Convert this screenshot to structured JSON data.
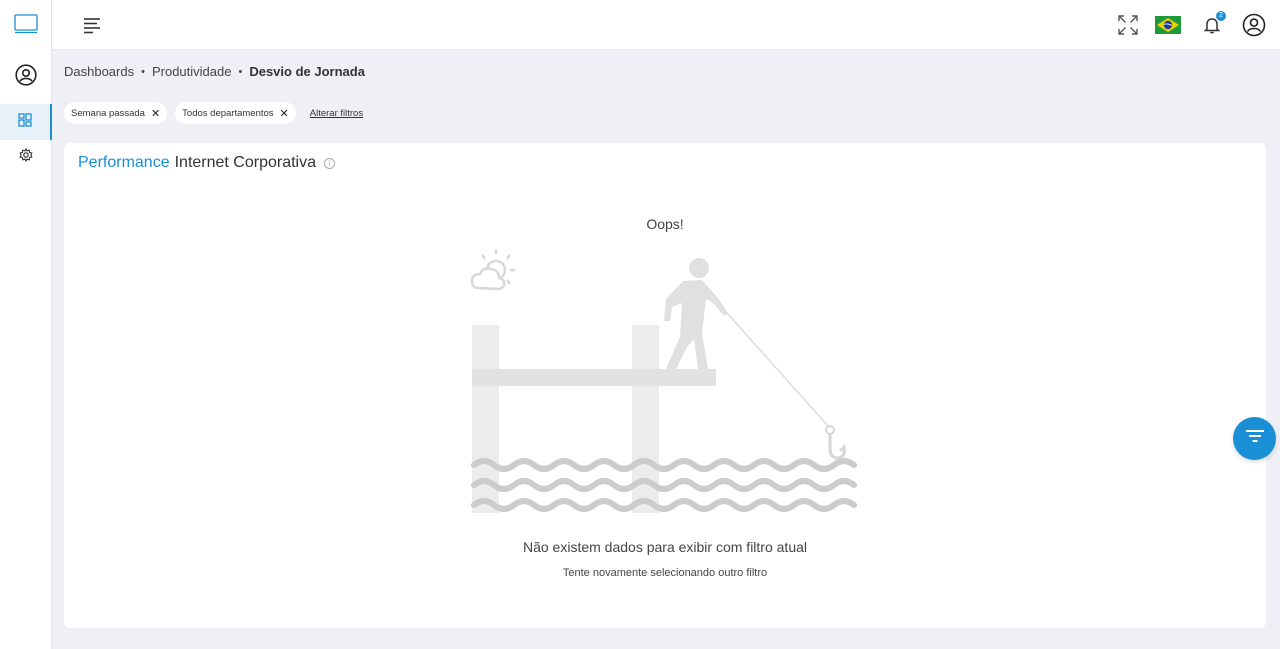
{
  "nav": {
    "items": [
      {
        "icon": "monitor-icon"
      },
      {
        "icon": "user-circle-icon"
      },
      {
        "icon": "dashboard-grid-icon",
        "active": true
      },
      {
        "icon": "gear-icon"
      }
    ]
  },
  "topbar": {
    "menu_icon": "hamburger-menu-icon",
    "actions": [
      "fullscreen-icon",
      "brazil-flag-icon",
      "bell-icon",
      "user-account-icon"
    ],
    "notification_count": "2"
  },
  "breadcrumb": {
    "items": [
      "Dashboards",
      "Produtividade",
      "Desvio de Jornada"
    ],
    "separator": "•"
  },
  "filters": {
    "chips": [
      "Semana passada",
      "Todos departamentos"
    ],
    "remove_symbol": "✕",
    "alter_label": "Alterar filtros"
  },
  "card": {
    "title_accent": "Performance",
    "title_rest": "Internet Corporativa",
    "info_symbol": "i",
    "oops": "Oops!",
    "empty_message": "Não existem dados para exibir com filtro atual",
    "empty_hint": "Tente novamente selecionando outro filtro"
  },
  "colors": {
    "accent": "#1a8fd6",
    "background": "#eef0f5",
    "illustration_gray": "#e6e6e6"
  },
  "fab": {
    "icon": "filter-icon"
  }
}
